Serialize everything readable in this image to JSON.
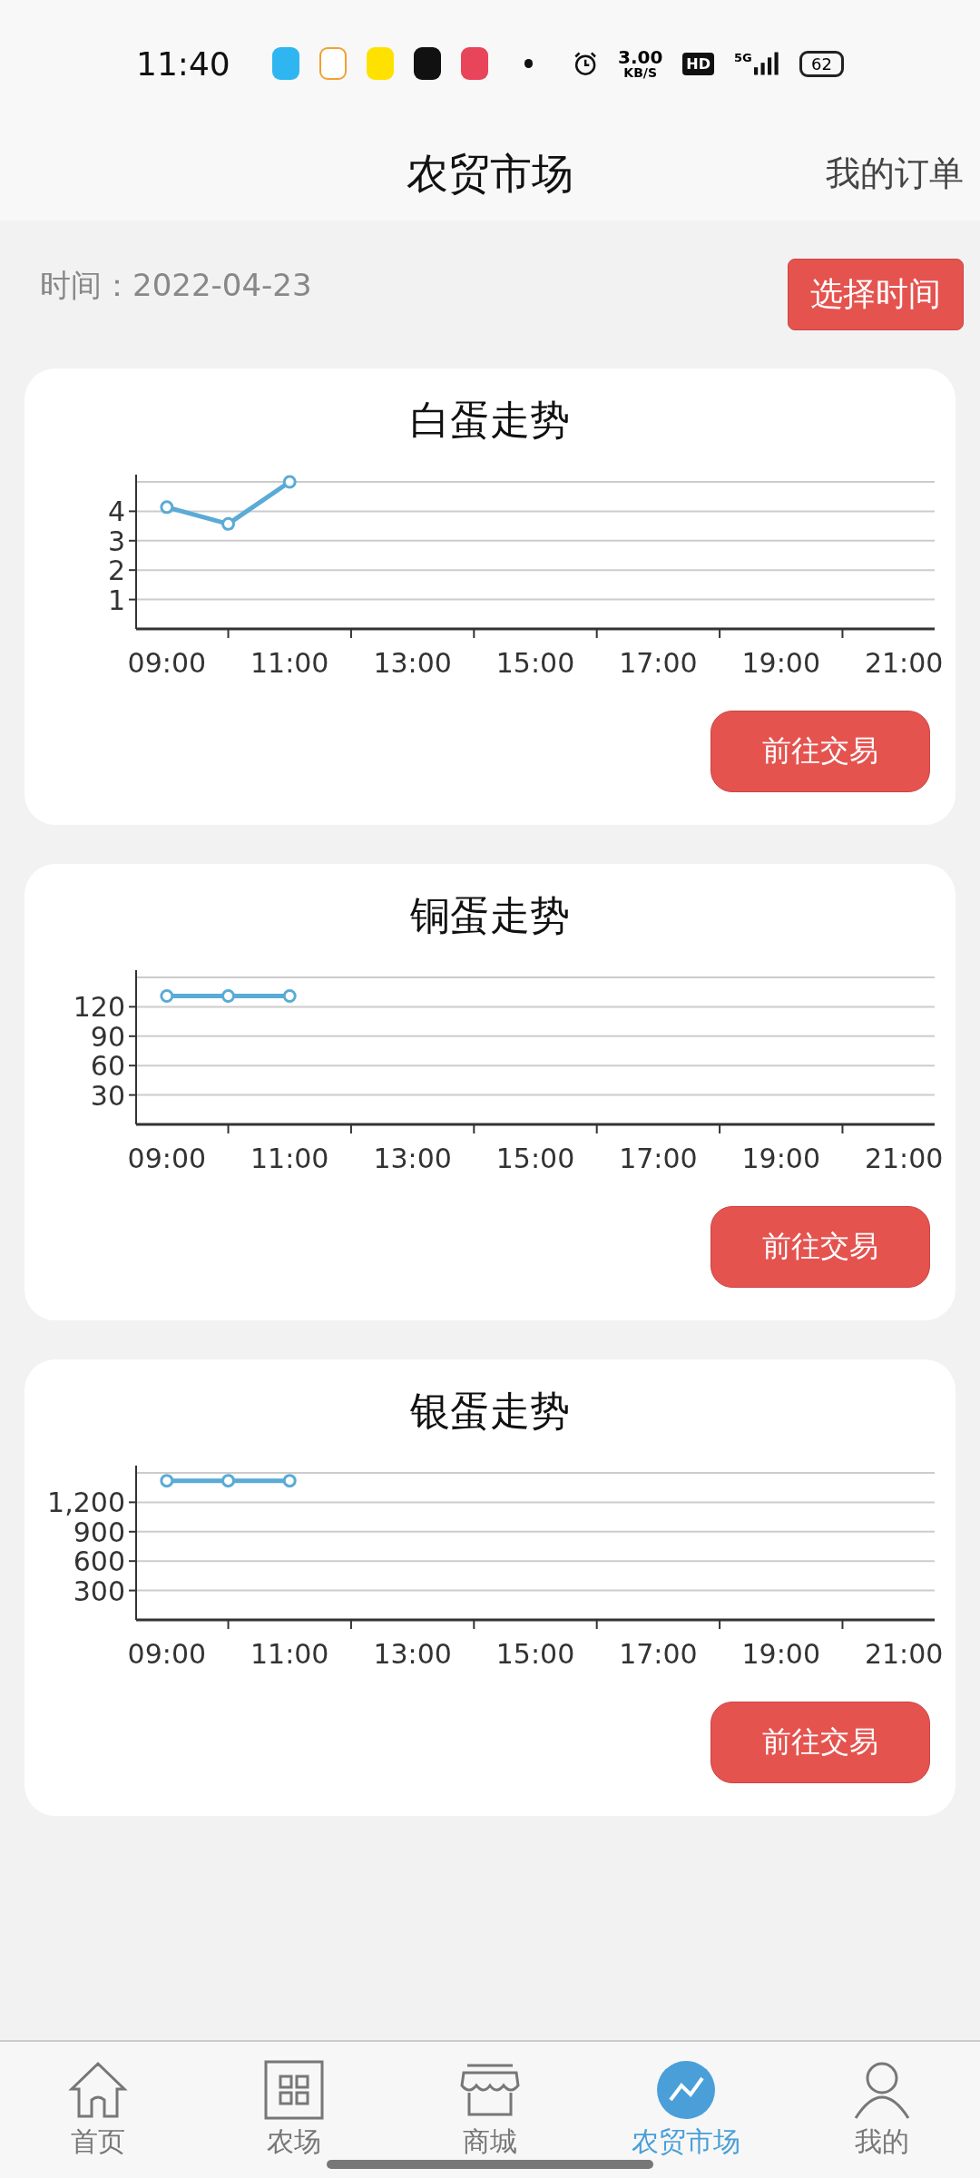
{
  "status_bar": {
    "time": "11:40",
    "speed_value": "3.00",
    "speed_unit": "KB/S",
    "hd": "HD",
    "network": "5G",
    "battery": "62"
  },
  "header": {
    "title": "农贸市场",
    "action": "我的订单"
  },
  "date_row": {
    "label": "时间：2022-04-23",
    "button": "选择时间"
  },
  "cards": [
    {
      "title": "白蛋走势",
      "button": "前往交易",
      "chart_data": {
        "type": "line",
        "x": [
          9,
          10,
          11
        ],
        "xlim": [
          8.5,
          21.5
        ],
        "ylim": [
          0,
          5
        ],
        "yticks": [
          1,
          2,
          3,
          4
        ],
        "xticks": [
          {
            "value": 9,
            "label": "09:00"
          },
          {
            "value": 11,
            "label": "11:00"
          },
          {
            "value": 13,
            "label": "13:00"
          },
          {
            "value": 15,
            "label": "15:00"
          },
          {
            "value": 17,
            "label": "17:00"
          },
          {
            "value": 19,
            "label": "19:00"
          },
          {
            "value": 21,
            "label": "21:00"
          }
        ],
        "grid": true,
        "series": [
          {
            "color": "#5aabd6",
            "marker": true,
            "values": [
              4.14,
              3.57,
              5
            ]
          }
        ]
      }
    },
    {
      "title": "铜蛋走势",
      "button": "前往交易",
      "chart_data": {
        "type": "line",
        "x": [
          9,
          10,
          11
        ],
        "xlim": [
          8.5,
          21.5
        ],
        "ylim": [
          0,
          150
        ],
        "yticks": [
          {
            "value": 30,
            "label": "30"
          },
          {
            "value": 60,
            "label": "60"
          },
          {
            "value": 90,
            "label": "90"
          },
          {
            "value": 120,
            "label": "120"
          }
        ],
        "xticks": [
          {
            "value": 9,
            "label": "09:00"
          },
          {
            "value": 11,
            "label": "11:00"
          },
          {
            "value": 13,
            "label": "13:00"
          },
          {
            "value": 15,
            "label": "15:00"
          },
          {
            "value": 17,
            "label": "17:00"
          },
          {
            "value": 19,
            "label": "19:00"
          },
          {
            "value": 21,
            "label": "21:00"
          }
        ],
        "grid": true,
        "series": [
          {
            "color": "#5aabd6",
            "marker": true,
            "values": [
              131,
              131,
              131
            ]
          }
        ]
      }
    },
    {
      "title": "银蛋走势",
      "button": "前往交易",
      "chart_data": {
        "type": "line",
        "x": [
          9,
          10,
          11
        ],
        "xlim": [
          8.5,
          21.5
        ],
        "ylim": [
          0,
          1500
        ],
        "yticks": [
          {
            "value": 300,
            "label": "300"
          },
          {
            "value": 600,
            "label": "600"
          },
          {
            "value": 900,
            "label": "900"
          },
          {
            "value": 1200,
            "label": "1,200"
          }
        ],
        "xticks": [
          {
            "value": 9,
            "label": "09:00"
          },
          {
            "value": 11,
            "label": "11:00"
          },
          {
            "value": 13,
            "label": "13:00"
          },
          {
            "value": 15,
            "label": "15:00"
          },
          {
            "value": 17,
            "label": "17:00"
          },
          {
            "value": 19,
            "label": "19:00"
          },
          {
            "value": 21,
            "label": "21:00"
          }
        ],
        "grid": true,
        "series": [
          {
            "color": "#5aabd6",
            "marker": true,
            "values": [
              1420,
              1420,
              1420
            ]
          }
        ]
      }
    }
  ],
  "nav": [
    {
      "label": "首页",
      "kind": "home",
      "selected": false
    },
    {
      "label": "农场",
      "kind": "grid",
      "selected": false
    },
    {
      "label": "商城",
      "kind": "shop",
      "selected": false
    },
    {
      "label": "农贸市场",
      "kind": "trend",
      "selected": true
    },
    {
      "label": "我的",
      "kind": "user",
      "selected": false
    }
  ]
}
